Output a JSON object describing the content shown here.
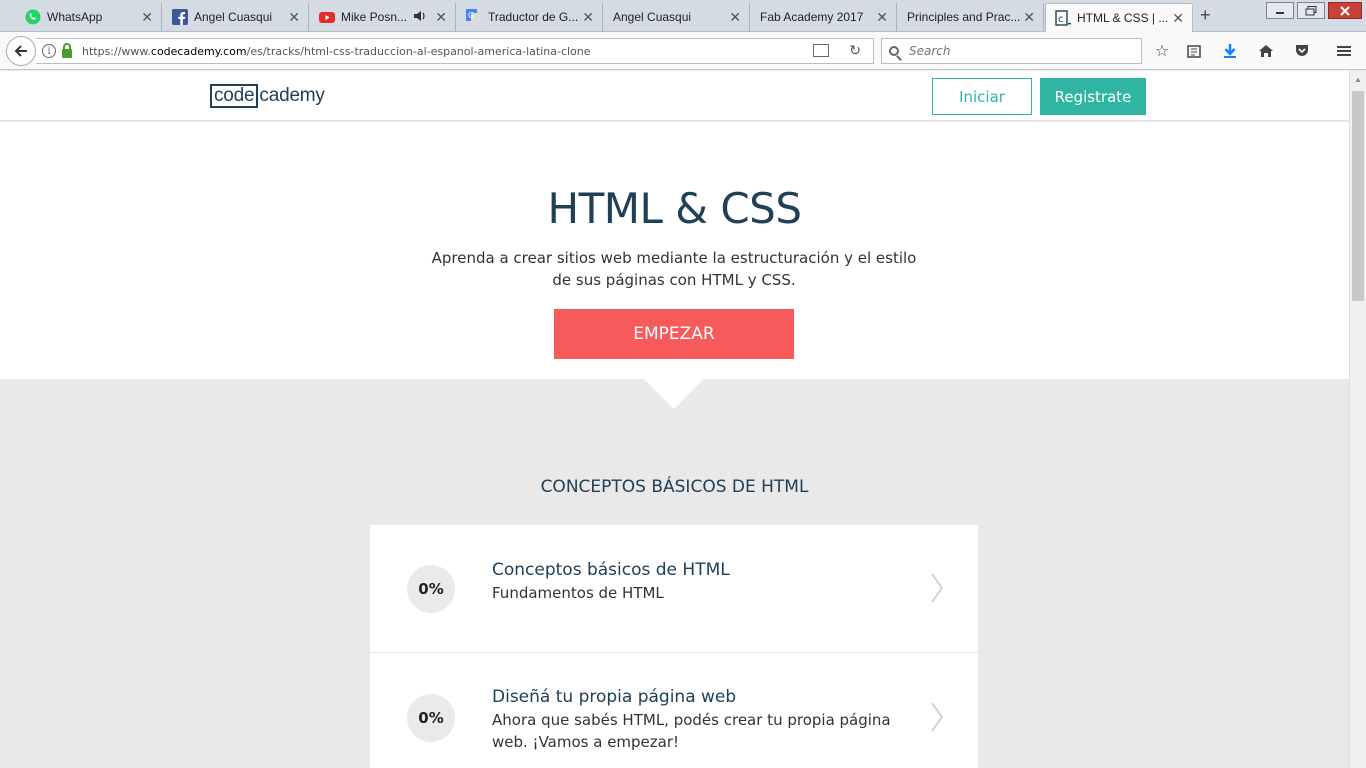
{
  "browser": {
    "tabs": [
      {
        "title": "WhatsApp",
        "icon": "whatsapp-icon",
        "color": "#25d366"
      },
      {
        "title": "Angel Cuasqui",
        "icon": "facebook-icon",
        "color": "#3b5998"
      },
      {
        "title": "Mike Posn...",
        "icon": "youtube-icon",
        "color": "#e52d27"
      },
      {
        "title": "Traductor de G...",
        "icon": "google-translate-icon",
        "color": "#4285f4"
      },
      {
        "title": "Angel Cuasqui",
        "icon": "",
        "color": ""
      },
      {
        "title": "Fab Academy 2017",
        "icon": "",
        "color": ""
      },
      {
        "title": "Principles and Prac...",
        "icon": "",
        "color": ""
      },
      {
        "title": "HTML & CSS | ...",
        "icon": "codecademy-icon",
        "color": "#204056",
        "active": true
      }
    ],
    "url_prefix": "https://www.",
    "url_host": "codecademy.com",
    "url_path": "/es/tracks/html-css-traduccion-al-espanol-america-latina-clone",
    "search_placeholder": "Search"
  },
  "header": {
    "logo_box": "code",
    "logo_rest": "cademy",
    "login_label": "Iniciar",
    "signup_label": "Registrate"
  },
  "hero": {
    "title": "HTML & CSS",
    "description": "Aprenda a crear sitios web mediante la estructuración y el estilo de sus páginas con HTML y CSS.",
    "cta_label": "EMPEZAR"
  },
  "section": {
    "title": "CONCEPTOS BÁSICOS DE HTML",
    "lessons": [
      {
        "progress": "0%",
        "title": "Conceptos básicos de HTML",
        "subtitle": "Fundamentos de HTML"
      },
      {
        "progress": "0%",
        "title": "Diseñá tu propia página web",
        "subtitle": "Ahora que sabés HTML, podés crear tu propia página web. ¡Vamos a empezar!"
      }
    ]
  },
  "colors": {
    "brand_navy": "#204056",
    "teal": "#2fb5a1",
    "coral": "#f65a5b",
    "page_bg": "#e8e9e8"
  }
}
